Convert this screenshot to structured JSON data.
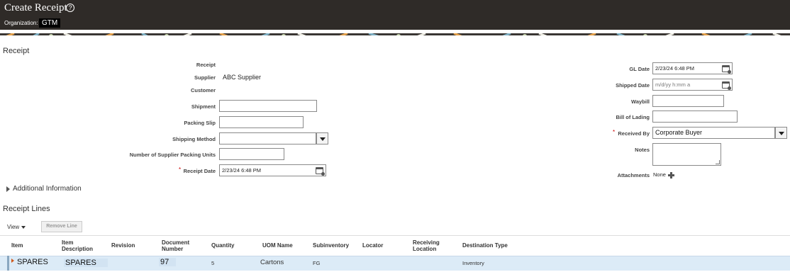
{
  "header": {
    "title": "Create Receipt",
    "help_icon": "?",
    "organization_label": "Organization:",
    "organization_value": "GTM"
  },
  "receipt": {
    "section_title": "Receipt",
    "receipt_label": "Receipt",
    "supplier_label": "Supplier",
    "supplier_value": "ABC Supplier",
    "customer_label": "Customer",
    "shipment_label": "Shipment",
    "shipment_value": "",
    "packing_slip_label": "Packing Slip",
    "packing_slip_value": "",
    "shipping_method_label": "Shipping Method",
    "shipping_method_value": "",
    "supplier_packing_units_label": "Number of Supplier Packing Units",
    "supplier_packing_units_value": "",
    "receipt_date_label": "Receipt Date",
    "receipt_date_value": "2/23/24 6:48 PM",
    "required_mark": "*"
  },
  "right_panel": {
    "gl_date_label": "GL Date",
    "gl_date_value": "2/23/24 6:48 PM",
    "shipped_date_label": "Shipped Date",
    "shipped_date_placeholder": "m/d/yy h:mm a",
    "waybill_label": "Waybill",
    "waybill_value": "",
    "bill_of_lading_label": "Bill of Lading",
    "bill_of_lading_value": "",
    "received_by_label": "Received By",
    "received_by_value": "Corporate Buyer",
    "notes_label": "Notes",
    "attachments_label": "Attachments",
    "attachments_value": "None",
    "required_mark": "*"
  },
  "additional_info": {
    "label": "Additional Information"
  },
  "receipt_lines": {
    "section_title": "Receipt Lines",
    "view_label": "View",
    "remove_line_label": "Remove Line",
    "columns": {
      "item": "Item",
      "item_description": "Item Description",
      "revision": "Revision",
      "document_number": "Document Number",
      "quantity": "Quantity",
      "uom_name": "UOM Name",
      "subinventory": "Subinventory",
      "locator": "Locator",
      "receiving_location": "Receiving Location",
      "destination_type": "Destination Type"
    },
    "rows": [
      {
        "item": "SPARES",
        "item_description": "SPARES",
        "revision": "",
        "document_number": "97",
        "quantity": "5",
        "uom_name": "Cartons",
        "subinventory": "FG",
        "locator": "",
        "receiving_location": "",
        "destination_type": "Inventory"
      }
    ]
  },
  "colors": {
    "header_bg": "#2f2b28",
    "row_highlight": "#dcebf7",
    "required": "#cc0000"
  },
  "icons": {
    "help": "help-icon",
    "calendar": "calendar-icon",
    "dropdown": "chevron-down-icon",
    "add": "plus-icon",
    "disclosure": "triangle-right-icon"
  }
}
